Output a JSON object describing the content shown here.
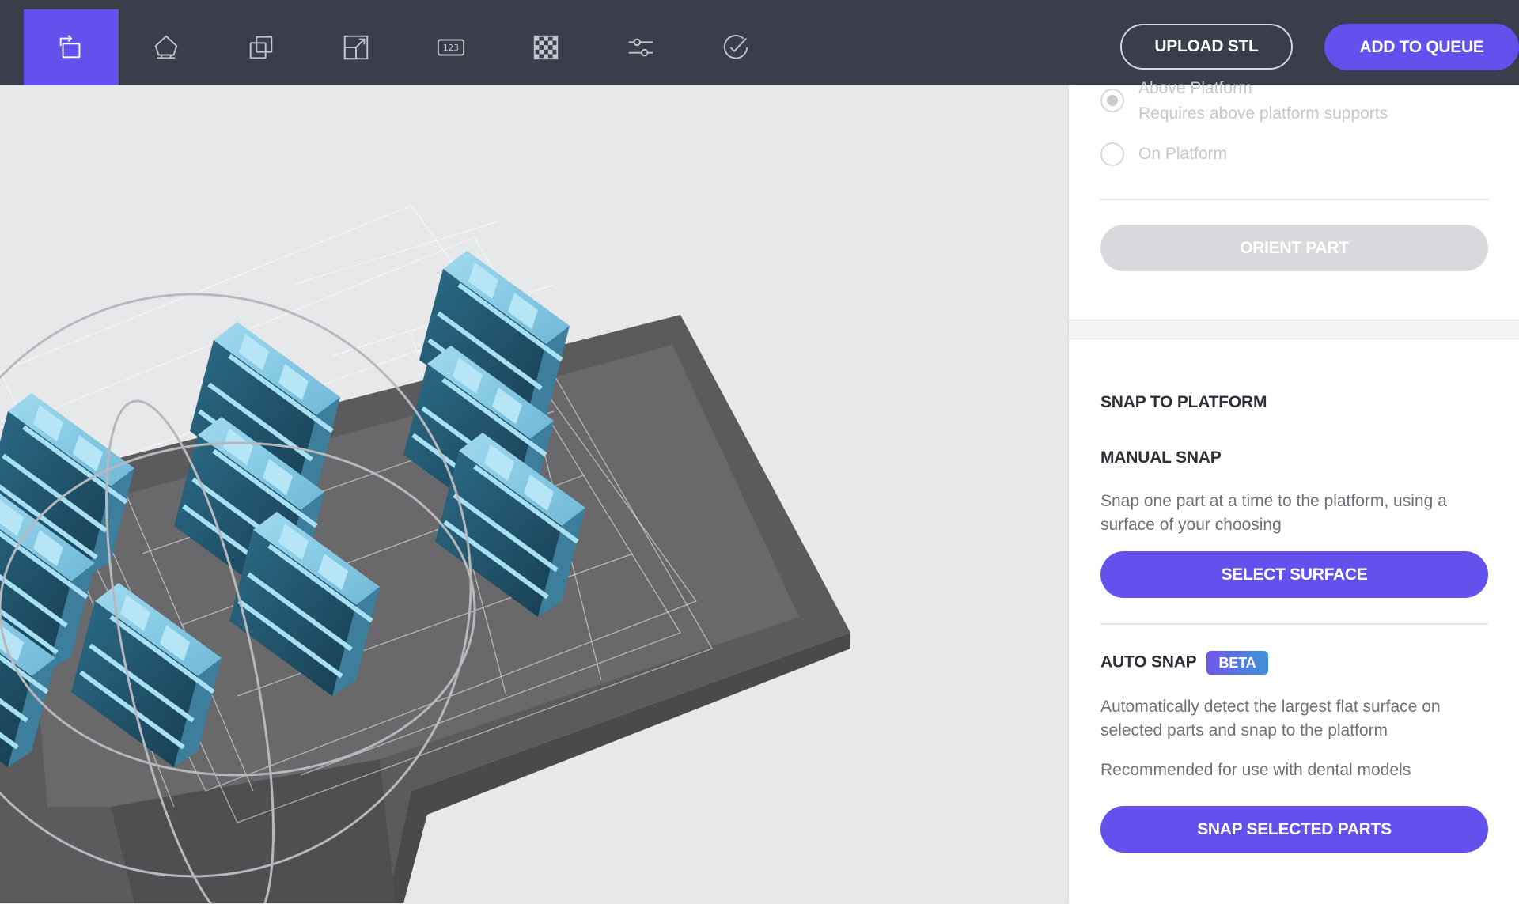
{
  "toolbar": {
    "tools": [
      {
        "icon": "orient-icon",
        "active": true
      },
      {
        "icon": "support-icon",
        "active": false
      },
      {
        "icon": "duplicate-icon",
        "active": false
      },
      {
        "icon": "scale-icon",
        "active": false
      },
      {
        "icon": "label-icon",
        "label": "123",
        "active": false
      },
      {
        "icon": "layout-grid-icon",
        "active": false
      },
      {
        "icon": "settings-sliders-icon",
        "active": false
      },
      {
        "icon": "check-circle-icon",
        "active": false
      }
    ],
    "upload_label": "UPLOAD STL",
    "queue_label": "ADD TO QUEUE"
  },
  "orientation": {
    "options": [
      {
        "label": "Above Platform",
        "sublabel": "Requires above platform supports",
        "checked": true
      },
      {
        "label": "On Platform",
        "checked": false
      }
    ],
    "orient_button": "ORIENT PART"
  },
  "snap": {
    "title": "SNAP TO PLATFORM",
    "manual_title": "MANUAL SNAP",
    "manual_desc": "Snap one part at a time to the platform, using a surface of your choosing",
    "select_button": "SELECT SURFACE",
    "auto_title": "AUTO SNAP",
    "beta_badge": "BETA",
    "auto_desc": "Automatically detect the largest flat surface on selected parts and snap to the platform",
    "recommend": "Recommended for use with dental models",
    "snap_button": "SNAP SELECTED PARTS"
  },
  "colors": {
    "accent": "#6450ec",
    "toolbar_bg": "#3a3d4a",
    "part": "#8ccfe9",
    "part_shadow": "#1f4f67",
    "platform": "#5a5a5c"
  }
}
